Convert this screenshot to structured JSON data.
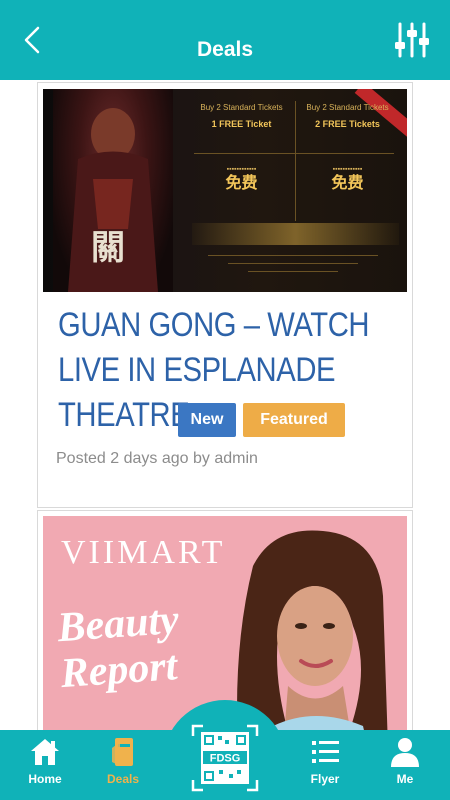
{
  "header": {
    "title": "Deals"
  },
  "deals": [
    {
      "title_lines": [
        "GUAN GONG – WATCH",
        "LIVE IN ESPLANADE",
        "THEATRE"
      ],
      "badges": {
        "new": "New",
        "featured": "Featured"
      },
      "posted": "Posted 2 days ago by admin",
      "banner": {
        "top_left_text": "Buy 2 Standard Tickets",
        "top_left_big": "1 FREE Ticket",
        "top_right_text": "Buy 2 Standard Tickets",
        "top_right_big": "2 FREE Tickets",
        "mid_left_big": "免费",
        "mid_right_big": "免费"
      }
    },
    {
      "banner": {
        "brand": "VIIMART",
        "headline_line1": "Beauty",
        "headline_line2": "Report"
      }
    }
  ],
  "bottom_nav": {
    "home": "Home",
    "deals": "Deals",
    "scan": "FDSG",
    "flyer": "Flyer",
    "me": "Me"
  },
  "colors": {
    "brand_teal": "#10b2b8",
    "title_blue": "#2d62a8",
    "badge_new": "#3b77c3",
    "badge_featured": "#eeac47",
    "active_nav": "#f0b24c"
  }
}
